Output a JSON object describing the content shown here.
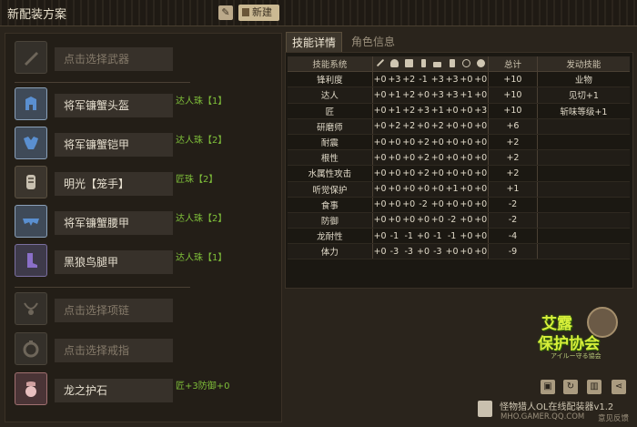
{
  "header": {
    "title": "新配装方案",
    "new_label": "新建"
  },
  "slots": [
    {
      "name": "点击选择武器",
      "placeholder": true,
      "jewel": ""
    },
    {
      "name": "将军镰蟹头盔",
      "placeholder": false,
      "jewel": "达人珠【1】"
    },
    {
      "name": "将军镰蟹铠甲",
      "placeholder": false,
      "jewel": "达人珠【2】"
    },
    {
      "name": "明光【笼手】",
      "placeholder": false,
      "jewel": "匠珠【2】"
    },
    {
      "name": "将军镰蟹腰甲",
      "placeholder": false,
      "jewel": "达人珠【2】"
    },
    {
      "name": "黑狼鸟腿甲",
      "placeholder": false,
      "jewel": "达人珠【1】"
    },
    {
      "name": "点击选择项链",
      "placeholder": true,
      "jewel": ""
    },
    {
      "name": "点击选择戒指",
      "placeholder": true,
      "jewel": ""
    },
    {
      "name": "龙之护石",
      "placeholder": false,
      "jewel": "匠+3防御+0"
    }
  ],
  "tabs": {
    "skills": "技能详情",
    "role": "角色信息"
  },
  "skill_table": {
    "col_skill": "技能系统",
    "col_total": "总计",
    "col_active": "发动技能",
    "rows": [
      {
        "name": "锋利度",
        "vals": [
          "+0",
          "+3",
          "+2",
          "-1",
          "+3",
          "+3",
          "+0",
          "+0"
        ],
        "total": "+10",
        "active": "业物"
      },
      {
        "name": "达人",
        "vals": [
          "+0",
          "+1",
          "+2",
          "+0",
          "+3",
          "+3",
          "+1",
          "+0"
        ],
        "total": "+10",
        "active": "见切+1"
      },
      {
        "name": "匠",
        "vals": [
          "+0",
          "+1",
          "+2",
          "+3",
          "+1",
          "+0",
          "+0",
          "+3"
        ],
        "total": "+10",
        "active": "斩味等级+1"
      },
      {
        "name": "研磨师",
        "vals": [
          "+0",
          "+2",
          "+2",
          "+0",
          "+2",
          "+0",
          "+0",
          "+0"
        ],
        "total": "+6",
        "active": ""
      },
      {
        "name": "耐震",
        "vals": [
          "+0",
          "+0",
          "+0",
          "+2",
          "+0",
          "+0",
          "+0",
          "+0"
        ],
        "total": "+2",
        "active": ""
      },
      {
        "name": "根性",
        "vals": [
          "+0",
          "+0",
          "+0",
          "+2",
          "+0",
          "+0",
          "+0",
          "+0"
        ],
        "total": "+2",
        "active": ""
      },
      {
        "name": "水属性攻击",
        "vals": [
          "+0",
          "+0",
          "+0",
          "+2",
          "+0",
          "+0",
          "+0",
          "+0"
        ],
        "total": "+2",
        "active": ""
      },
      {
        "name": "听觉保护",
        "vals": [
          "+0",
          "+0",
          "+0",
          "+0",
          "+0",
          "+1",
          "+0",
          "+0"
        ],
        "total": "+1",
        "active": ""
      },
      {
        "name": "食事",
        "vals": [
          "+0",
          "+0",
          "+0",
          "-2",
          "+0",
          "+0",
          "+0",
          "+0"
        ],
        "total": "-2",
        "active": ""
      },
      {
        "name": "防御",
        "vals": [
          "+0",
          "+0",
          "+0",
          "+0",
          "+0",
          "-2",
          "+0",
          "+0"
        ],
        "total": "-2",
        "active": ""
      },
      {
        "name": "龙耐性",
        "vals": [
          "+0",
          "-1",
          "-1",
          "+0",
          "-1",
          "-1",
          "+0",
          "+0"
        ],
        "total": "-4",
        "active": ""
      },
      {
        "name": "体力",
        "vals": [
          "+0",
          "-3",
          "-3",
          "+0",
          "-3",
          "+0",
          "+0",
          "+0"
        ],
        "total": "-9",
        "active": ""
      }
    ]
  },
  "logo": {
    "line1": "艾露",
    "line2": "保护协会",
    "tagline": "アイルー守る協会"
  },
  "footer": {
    "title": "怪物猎人OL在线配装器v1.2",
    "site": "MHO.GAMER.QQ.COM",
    "feedback": "意见反馈"
  }
}
